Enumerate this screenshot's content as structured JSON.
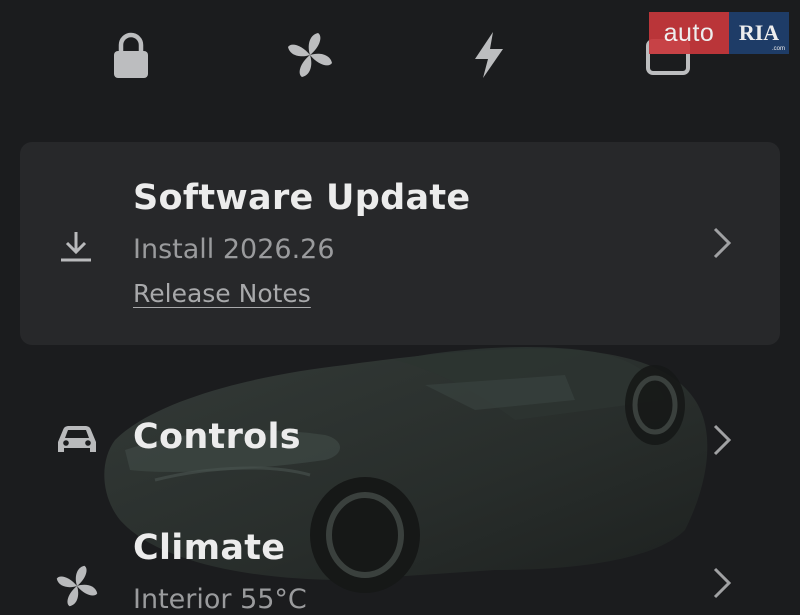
{
  "top_icons": [
    "lock-icon",
    "fan-icon",
    "lightning-icon",
    "window-icon"
  ],
  "watermark": {
    "left": "auto",
    "right": "RIA",
    "suffix": ".com"
  },
  "update": {
    "title": "Software Update",
    "subtitle": "Install 2026.26",
    "link": "Release Notes"
  },
  "controls": {
    "title": "Controls"
  },
  "climate": {
    "title": "Climate",
    "subtitle": "Interior 55°C"
  },
  "colors": {
    "background": "#1b1c1e",
    "card": "#27282a",
    "text": "#ececec",
    "muted": "#9a9b9d",
    "icon": "#b9babc"
  }
}
